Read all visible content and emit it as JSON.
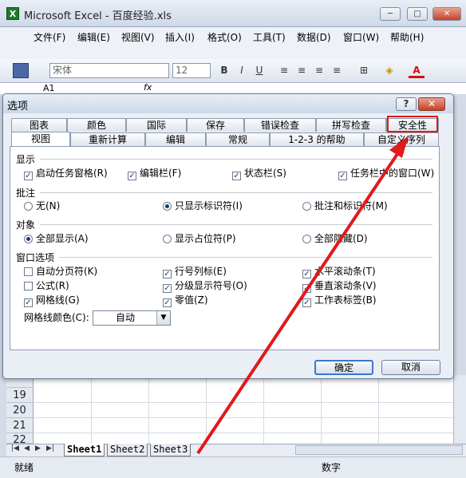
{
  "app": {
    "title": "Microsoft Excel - 百度经验.xls",
    "logo": "X",
    "window_controls": [
      "─",
      "□",
      "✕"
    ]
  },
  "menubar": {
    "items": [
      "文件(F)",
      "编辑(E)",
      "视图(V)",
      "插入(I)",
      "格式(O)",
      "工具(T)",
      "数据(D)",
      "窗口(W)",
      "帮助(H)"
    ]
  },
  "toolbar": {
    "font_name": "宋体",
    "font_size": "12",
    "bold": "B",
    "italic": "I",
    "underline": "U",
    "font_color_label": "A"
  },
  "formula_bar": {
    "name_box": "A1",
    "fx": "fx"
  },
  "sheet": {
    "rows": [
      "19",
      "20",
      "21",
      "22"
    ],
    "tabs": [
      "Sheet1",
      "Sheet2",
      "Sheet3"
    ],
    "nav": [
      "|◀",
      "◀",
      "▶",
      "▶|"
    ]
  },
  "statusbar": {
    "left": "就绪",
    "right": "数字"
  },
  "dialog": {
    "title": "选项",
    "help": "?",
    "close": "✕",
    "tabs_row1": [
      "图表",
      "颜色",
      "国际",
      "保存",
      "错误检查",
      "拼写检查",
      "安全性"
    ],
    "tabs_row2": [
      "视图",
      "重新计算",
      "编辑",
      "常规",
      "1-2-3 的帮助",
      "自定义序列"
    ],
    "sections": {
      "display": "显示",
      "comments": "批注",
      "objects": "对象",
      "window_options": "窗口选项"
    },
    "display_options": [
      {
        "label": "启动任务窗格(R)",
        "checked": true
      },
      {
        "label": "编辑栏(F)",
        "checked": true
      },
      {
        "label": "状态栏(S)",
        "checked": true
      },
      {
        "label": "任务栏中的窗口(W)",
        "checked": true
      }
    ],
    "comment_options": [
      {
        "label": "无(N)",
        "selected": false
      },
      {
        "label": "只显示标识符(I)",
        "selected": true
      },
      {
        "label": "批注和标识符(M)",
        "selected": false
      }
    ],
    "object_options": [
      {
        "label": "全部显示(A)",
        "selected": true
      },
      {
        "label": "显示占位符(P)",
        "selected": false
      },
      {
        "label": "全部隐藏(D)",
        "selected": false
      }
    ],
    "window_options": [
      {
        "label": "自动分页符(K)",
        "checked": false
      },
      {
        "label": "行号列标(E)",
        "checked": true
      },
      {
        "label": "水平滚动条(T)",
        "checked": true
      },
      {
        "label": "公式(R)",
        "checked": false
      },
      {
        "label": "分级显示符号(O)",
        "checked": true
      },
      {
        "label": "垂直滚动条(V)",
        "checked": true
      },
      {
        "label": "网格线(G)",
        "checked": true
      },
      {
        "label": "零值(Z)",
        "checked": true
      },
      {
        "label": "工作表标签(B)",
        "checked": true
      }
    ],
    "gridline_color_label": "网格线颜色(C):",
    "gridline_color_value": "自动",
    "ok": "确定",
    "cancel": "取消"
  },
  "colors": {
    "highlight": "#e11a1a",
    "arrow": "#e11a1a",
    "check": "#1c3a73"
  }
}
